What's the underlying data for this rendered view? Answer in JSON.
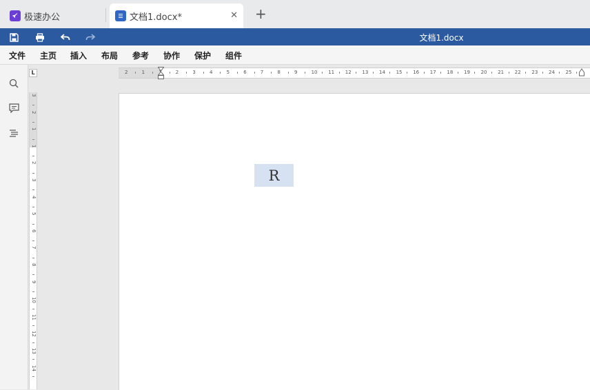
{
  "tabs": [
    {
      "label": "极速办公",
      "icon": "rocket-icon",
      "active": false
    },
    {
      "label": "文档1.docx*",
      "icon": "document-icon",
      "active": true
    }
  ],
  "new_tab_label": "+",
  "close_label": "✕",
  "quick_access": {
    "title": "文档1.docx",
    "buttons": [
      "save-icon",
      "print-icon",
      "undo-icon",
      "redo-icon"
    ]
  },
  "menu": [
    "文件",
    "主页",
    "插入",
    "布局",
    "参考",
    "协作",
    "保护",
    "组件"
  ],
  "side_tools": [
    "search-icon",
    "comment-icon",
    "navigation-icon"
  ],
  "ruler": {
    "corner_label": "L",
    "h_numbers": [
      "2",
      "1",
      "1",
      "2",
      "3",
      "4",
      "5",
      "6",
      "7",
      "8",
      "9",
      "10",
      "11",
      "12",
      "13",
      "14",
      "15",
      "16",
      "17",
      "18",
      "19",
      "20",
      "21",
      "22",
      "23",
      "24",
      "25"
    ],
    "v_numbers": [
      "3",
      "2",
      "1",
      "1",
      "2",
      "3",
      "4",
      "5",
      "6",
      "7",
      "8",
      "9",
      "10",
      "11",
      "12",
      "13",
      "14"
    ]
  },
  "document": {
    "selected_text": "R"
  },
  "colors": {
    "accent": "#2c5aa0",
    "selection": "#d6e1f2",
    "tab_active": "#ffffff"
  }
}
